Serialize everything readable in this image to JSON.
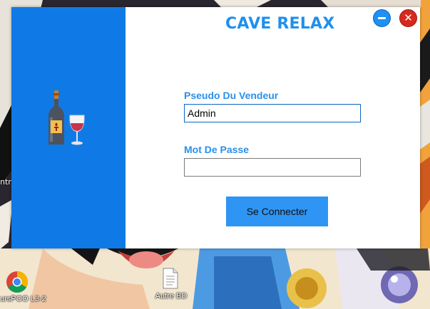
{
  "window": {
    "title": "CAVE RELAX",
    "minimize_icon": "minimize-icon",
    "close_icon": "close-icon",
    "close_glyph": "✕"
  },
  "form": {
    "username_label": "Pseudo Du Vendeur",
    "username_value": "Admin",
    "password_label": "Mot De Passe",
    "password_value": "",
    "submit_label": "Se Connecter"
  },
  "desktop": {
    "icons": [
      {
        "name": "chrome",
        "label": "ursPOO L3-2"
      },
      {
        "name": "document",
        "label": "Autre BD"
      }
    ],
    "edge_label": "ntr"
  },
  "colors": {
    "side_panel": "#0f7ae5",
    "title": "#1e90f0",
    "button": "#2e95f4",
    "close": "#d62a1e"
  }
}
